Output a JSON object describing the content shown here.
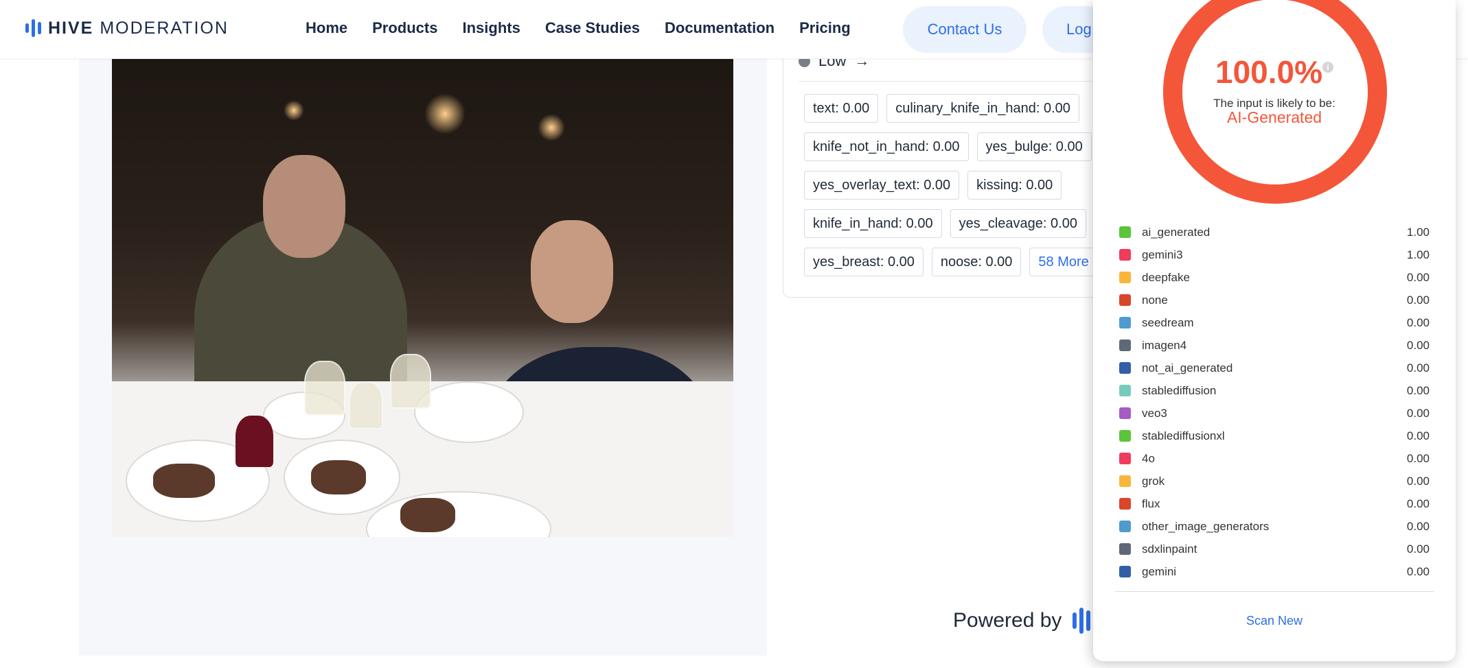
{
  "header": {
    "logo_bold": "HIVE",
    "logo_light": "MODERATION",
    "nav": [
      "Home",
      "Products",
      "Insights",
      "Case Studies",
      "Documentation",
      "Pricing"
    ],
    "contact_label": "Contact Us",
    "login_label": "Log"
  },
  "results": {
    "low_label": "Low",
    "low_arrow": "→",
    "chips": [
      [
        "text: 0.00",
        "culinary_knife_in_hand: 0.00"
      ],
      [
        "knife_not_in_hand: 0.00",
        "yes_bulge: 0.00"
      ],
      [
        "yes_overlay_text: 0.00",
        "kissing: 0.00"
      ],
      [
        "knife_in_hand: 0.00",
        "yes_cleavage: 0.00"
      ],
      [
        "yes_breast: 0.00",
        "noose: 0.00",
        "58 More"
      ]
    ]
  },
  "powered_by": "Powered by",
  "popup": {
    "score": "100.0%",
    "info_glyph": "i",
    "likely_text": "The input is likely to be:",
    "verdict": "AI-Generated",
    "ring_color": "#f4563a",
    "items": [
      {
        "name": "ai_generated",
        "value": "1.00",
        "color": "#5ac43b"
      },
      {
        "name": "gemini3",
        "value": "1.00",
        "color": "#ef3b5c"
      },
      {
        "name": "deepfake",
        "value": "0.00",
        "color": "#f9b63a"
      },
      {
        "name": "none",
        "value": "0.00",
        "color": "#d9472a"
      },
      {
        "name": "seedream",
        "value": "0.00",
        "color": "#4f9bd0"
      },
      {
        "name": "imagen4",
        "value": "0.00",
        "color": "#5e6877"
      },
      {
        "name": "not_ai_generated",
        "value": "0.00",
        "color": "#2f5fa6"
      },
      {
        "name": "stablediffusion",
        "value": "0.00",
        "color": "#76cbbc"
      },
      {
        "name": "veo3",
        "value": "0.00",
        "color": "#a45bc5"
      },
      {
        "name": "stablediffusionxl",
        "value": "0.00",
        "color": "#5ac43b"
      },
      {
        "name": "4o",
        "value": "0.00",
        "color": "#ef3b5c"
      },
      {
        "name": "grok",
        "value": "0.00",
        "color": "#f9b63a"
      },
      {
        "name": "flux",
        "value": "0.00",
        "color": "#d9472a"
      },
      {
        "name": "other_image_generators",
        "value": "0.00",
        "color": "#4f9bd0"
      },
      {
        "name": "sdxlinpaint",
        "value": "0.00",
        "color": "#5e6877"
      },
      {
        "name": "gemini",
        "value": "0.00",
        "color": "#2f5fa6"
      }
    ],
    "scan_new": "Scan New"
  }
}
